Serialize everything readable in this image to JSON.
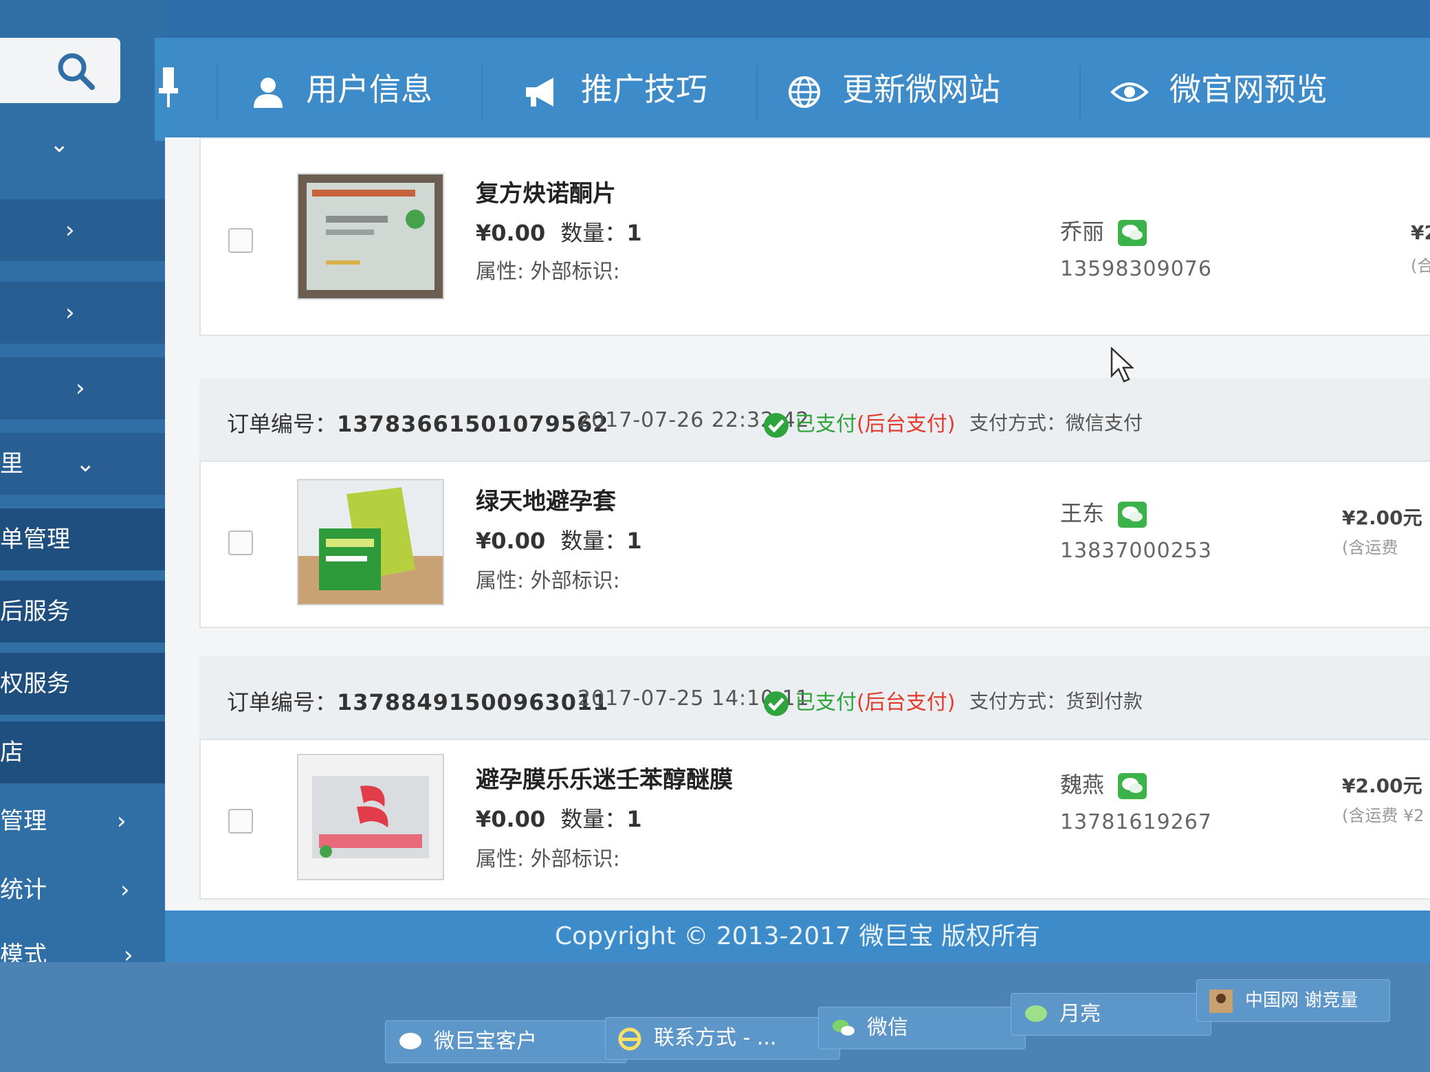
{
  "nav": {
    "items": [
      {
        "label": "用户信息",
        "icon": "user-icon"
      },
      {
        "label": "推广技巧",
        "icon": "megaphone-icon"
      },
      {
        "label": "更新微网站",
        "icon": "globe-icon"
      },
      {
        "label": "微官网预览",
        "icon": "eye-icon"
      }
    ]
  },
  "sidebar": {
    "items": [
      {
        "label": "",
        "arrow": "⌄"
      },
      {
        "label": "",
        "arrow": "›"
      },
      {
        "label": "",
        "arrow": "›"
      },
      {
        "label": "",
        "arrow": "›"
      },
      {
        "label": "里",
        "arrow": "⌄"
      },
      {
        "label": "单管理",
        "arrow": ""
      },
      {
        "label": "后服务",
        "arrow": ""
      },
      {
        "label": "权服务",
        "arrow": ""
      },
      {
        "label": "店",
        "arrow": ""
      },
      {
        "label": "管理",
        "arrow": "›"
      },
      {
        "label": "统计",
        "arrow": "›"
      },
      {
        "label": "模式",
        "arrow": "›"
      }
    ]
  },
  "orders": [
    {
      "id_label": "",
      "id": "",
      "time": "",
      "status": "",
      "status_note": "",
      "pay_method": "",
      "product": {
        "name": "复方炔诺酮片",
        "price": "¥0.00",
        "qty_label": "数量：",
        "qty": "1",
        "attr": "属性: 外部标识:"
      },
      "buyer": {
        "name": "乔丽",
        "phone": "13598309076"
      },
      "amount": "¥2",
      "amount_note": "(合"
    },
    {
      "id_label": "订单编号：",
      "id": "13783661501079562",
      "time": "2017-07-26 22:32:42",
      "status": "已支付",
      "status_note": "(后台支付)",
      "pay_method": "支付方式：微信支付",
      "product": {
        "name": "绿天地避孕套",
        "price": "¥0.00",
        "qty_label": "数量：",
        "qty": "1",
        "attr": "属性: 外部标识:"
      },
      "buyer": {
        "name": "王东",
        "phone": "13837000253"
      },
      "amount": "¥2.00元",
      "amount_note": "(含运费"
    },
    {
      "id_label": "订单编号：",
      "id": "13788491500963011",
      "time": "2017-07-25 14:10:11",
      "status": "已支付",
      "status_note": "(后台支付)",
      "pay_method": "支付方式：货到付款",
      "product": {
        "name": "避孕膜乐乐迷壬苯醇醚膜",
        "price": "¥0.00",
        "qty_label": "数量：",
        "qty": "1",
        "attr": "属性: 外部标识:"
      },
      "buyer": {
        "name": "魏燕",
        "phone": "13781619267"
      },
      "amount": "¥2.00元",
      "amount_note": "(含运费 ¥2"
    }
  ],
  "footer": {
    "text": "Copyright © 2013-2017 微巨宝 版权所有"
  },
  "taskbar": {
    "items": [
      {
        "label": "微巨宝客户"
      },
      {
        "label": "联系方式 - ..."
      },
      {
        "label": "微信"
      },
      {
        "label": "月亮"
      },
      {
        "label": "中国网 谢竞量"
      }
    ]
  },
  "colors": {
    "accent": "#3d8bc9",
    "paid": "#2ea43d",
    "note": "#e23b2e"
  }
}
